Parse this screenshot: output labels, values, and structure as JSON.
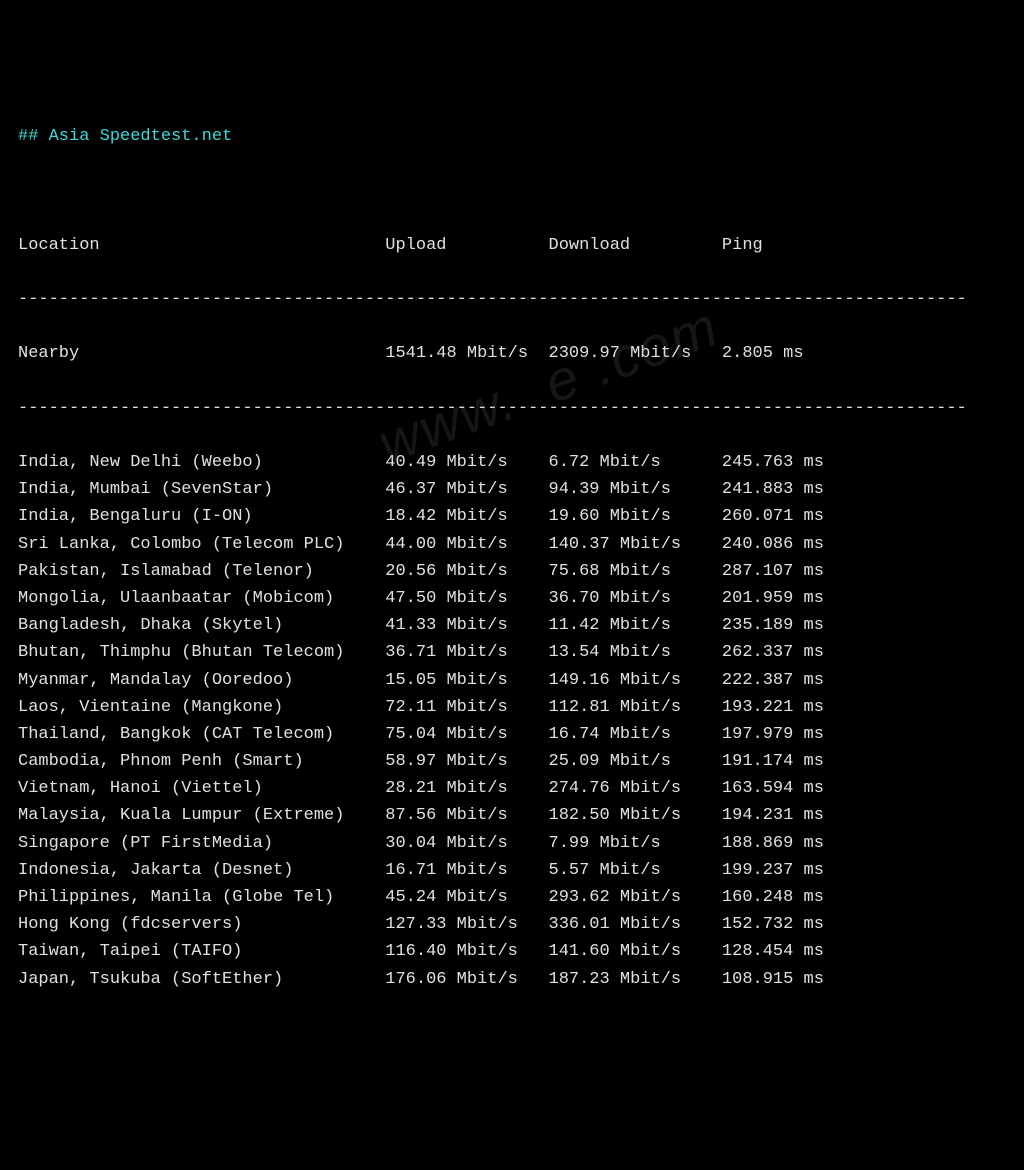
{
  "title": "## Asia Speedtest.net",
  "watermark": "www.  e .com",
  "header": {
    "location": "Location",
    "upload": "Upload",
    "download": "Download",
    "ping": "Ping"
  },
  "nearby": {
    "location": "Nearby",
    "upload": "1541.48 Mbit/s",
    "download": "2309.97 Mbit/s",
    "ping": "2.805 ms"
  },
  "rows": [
    {
      "location": "India, New Delhi (Weebo)",
      "upload": "40.49 Mbit/s",
      "download": "6.72 Mbit/s",
      "ping": "245.763 ms"
    },
    {
      "location": "India, Mumbai (SevenStar)",
      "upload": "46.37 Mbit/s",
      "download": "94.39 Mbit/s",
      "ping": "241.883 ms"
    },
    {
      "location": "India, Bengaluru (I-ON)",
      "upload": "18.42 Mbit/s",
      "download": "19.60 Mbit/s",
      "ping": "260.071 ms"
    },
    {
      "location": "Sri Lanka, Colombo (Telecom PLC)",
      "upload": "44.00 Mbit/s",
      "download": "140.37 Mbit/s",
      "ping": "240.086 ms"
    },
    {
      "location": "Pakistan, Islamabad (Telenor)",
      "upload": "20.56 Mbit/s",
      "download": "75.68 Mbit/s",
      "ping": "287.107 ms"
    },
    {
      "location": "Mongolia, Ulaanbaatar (Mobicom)",
      "upload": "47.50 Mbit/s",
      "download": "36.70 Mbit/s",
      "ping": "201.959 ms"
    },
    {
      "location": "Bangladesh, Dhaka (Skytel)",
      "upload": "41.33 Mbit/s",
      "download": "11.42 Mbit/s",
      "ping": "235.189 ms"
    },
    {
      "location": "Bhutan, Thimphu (Bhutan Telecom)",
      "upload": "36.71 Mbit/s",
      "download": "13.54 Mbit/s",
      "ping": "262.337 ms"
    },
    {
      "location": "Myanmar, Mandalay (Ooredoo)",
      "upload": "15.05 Mbit/s",
      "download": "149.16 Mbit/s",
      "ping": "222.387 ms"
    },
    {
      "location": "Laos, Vientaine (Mangkone)",
      "upload": "72.11 Mbit/s",
      "download": "112.81 Mbit/s",
      "ping": "193.221 ms"
    },
    {
      "location": "Thailand, Bangkok (CAT Telecom)",
      "upload": "75.04 Mbit/s",
      "download": "16.74 Mbit/s",
      "ping": "197.979 ms"
    },
    {
      "location": "Cambodia, Phnom Penh (Smart)",
      "upload": "58.97 Mbit/s",
      "download": "25.09 Mbit/s",
      "ping": "191.174 ms"
    },
    {
      "location": "Vietnam, Hanoi (Viettel)",
      "upload": "28.21 Mbit/s",
      "download": "274.76 Mbit/s",
      "ping": "163.594 ms"
    },
    {
      "location": "Malaysia, Kuala Lumpur (Extreme)",
      "upload": "87.56 Mbit/s",
      "download": "182.50 Mbit/s",
      "ping": "194.231 ms"
    },
    {
      "location": "Singapore (PT FirstMedia)",
      "upload": "30.04 Mbit/s",
      "download": "7.99 Mbit/s",
      "ping": "188.869 ms"
    },
    {
      "location": "Indonesia, Jakarta (Desnet)",
      "upload": "16.71 Mbit/s",
      "download": "5.57 Mbit/s",
      "ping": "199.237 ms"
    },
    {
      "location": "Philippines, Manila (Globe Tel)",
      "upload": "45.24 Mbit/s",
      "download": "293.62 Mbit/s",
      "ping": "160.248 ms"
    },
    {
      "location": "Hong Kong (fdcservers)",
      "upload": "127.33 Mbit/s",
      "download": "336.01 Mbit/s",
      "ping": "152.732 ms"
    },
    {
      "location": "Taiwan, Taipei (TAIFO)",
      "upload": "116.40 Mbit/s",
      "download": "141.60 Mbit/s",
      "ping": "128.454 ms"
    },
    {
      "location": "Japan, Tsukuba (SoftEther)",
      "upload": "176.06 Mbit/s",
      "download": "187.23 Mbit/s",
      "ping": "108.915 ms"
    }
  ],
  "cols": {
    "loc": 36,
    "up": 16,
    "dl": 17,
    "ping": 12
  },
  "dash_len": 93
}
